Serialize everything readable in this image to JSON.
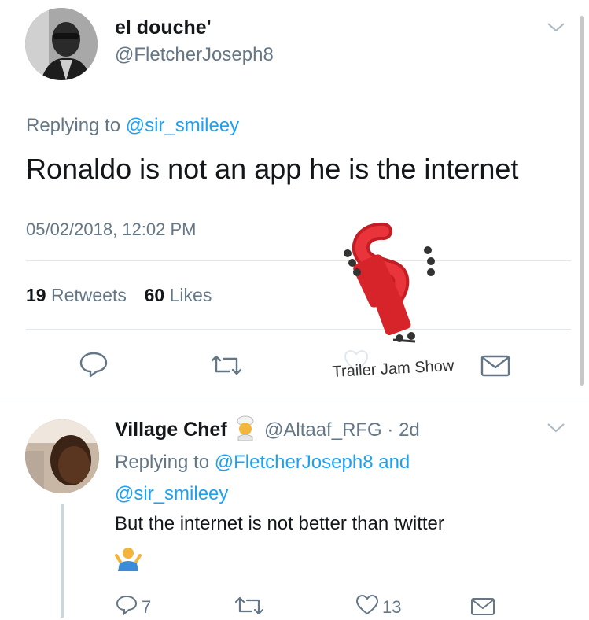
{
  "main_tweet": {
    "display_name": "el douche'",
    "handle": "@FletcherJoseph8",
    "replying_prefix": "Replying to",
    "replying_to": "@sir_smileey",
    "text": "Ronaldo is not an app he is the internet",
    "timestamp": "05/02/2018, 12:02 PM",
    "retweets_count": "19",
    "retweets_label": "Retweets",
    "likes_count": "60",
    "likes_label": "Likes",
    "icons": [
      "reply-icon",
      "retweet-icon",
      "like-icon",
      "share-icon",
      "chevron-down-icon"
    ]
  },
  "watermark": {
    "label": "Trailer Jam Show"
  },
  "reply_tweet": {
    "display_name": "Village Chef",
    "handle": "@Altaaf_RFG",
    "separator": "·",
    "age": "2d",
    "replying_prefix": "Replying to",
    "replying_to_1": "@FletcherJoseph8",
    "replying_and": "and",
    "replying_to_2": "@sir_smileey",
    "text": "But the internet is not better than twitter",
    "reply_count": "7",
    "like_count": "13",
    "icons": [
      "chef-emoji-icon",
      "shrug-emoji-icon",
      "reply-icon",
      "retweet-icon",
      "like-icon",
      "share-icon",
      "chevron-down-icon"
    ]
  },
  "colors": {
    "link": "#1da1f2",
    "muted": "#657786",
    "text": "#14171a",
    "divider": "#e1e8ed",
    "truck_red": "#d7242b"
  }
}
